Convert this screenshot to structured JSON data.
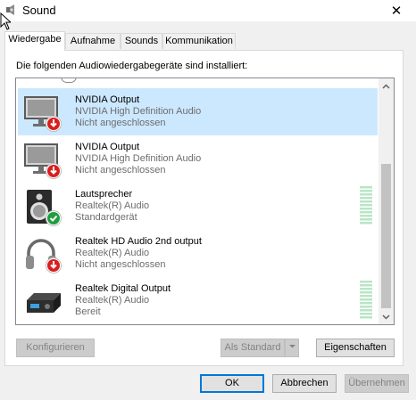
{
  "window": {
    "title": "Sound",
    "close_label": "✕"
  },
  "tabs": [
    {
      "label": "Wiedergabe"
    },
    {
      "label": "Aufnahme"
    },
    {
      "label": "Sounds"
    },
    {
      "label": "Kommunikation"
    }
  ],
  "panel": {
    "heading": "Die folgenden Audiowiedergabegeräte sind installiert:"
  },
  "devices": [
    {
      "name": "NVIDIA Output",
      "driver": "NVIDIA High Definition Audio",
      "status": "Nicht angeschlossen",
      "icon": "monitor-icon",
      "badge": "disconnected",
      "selected": true
    },
    {
      "name": "NVIDIA Output",
      "driver": "NVIDIA High Definition Audio",
      "status": "Nicht angeschlossen",
      "icon": "monitor-icon",
      "badge": "disconnected",
      "selected": false
    },
    {
      "name": "Lautsprecher",
      "driver": "Realtek(R) Audio",
      "status": "Standardgerät",
      "icon": "speaker-icon",
      "badge": "default",
      "selected": false
    },
    {
      "name": "Realtek HD Audio 2nd output",
      "driver": "Realtek(R) Audio",
      "status": "Nicht angeschlossen",
      "icon": "headphones-icon",
      "badge": "disconnected",
      "selected": false
    },
    {
      "name": "Realtek Digital Output",
      "driver": "Realtek(R) Audio",
      "status": "Bereit",
      "icon": "digital-receiver-icon",
      "badge": "none",
      "selected": false
    }
  ],
  "buttons": {
    "configure": "Konfigurieren",
    "set_default": "Als Standard",
    "properties": "Eigenschaften",
    "ok": "OK",
    "cancel": "Abbrechen",
    "apply": "Übernehmen"
  },
  "colors": {
    "selection": "#cce8ff",
    "accent": "#0078d7",
    "disconnected": "#d81e1e",
    "default_badge": "#1e9e3e"
  }
}
